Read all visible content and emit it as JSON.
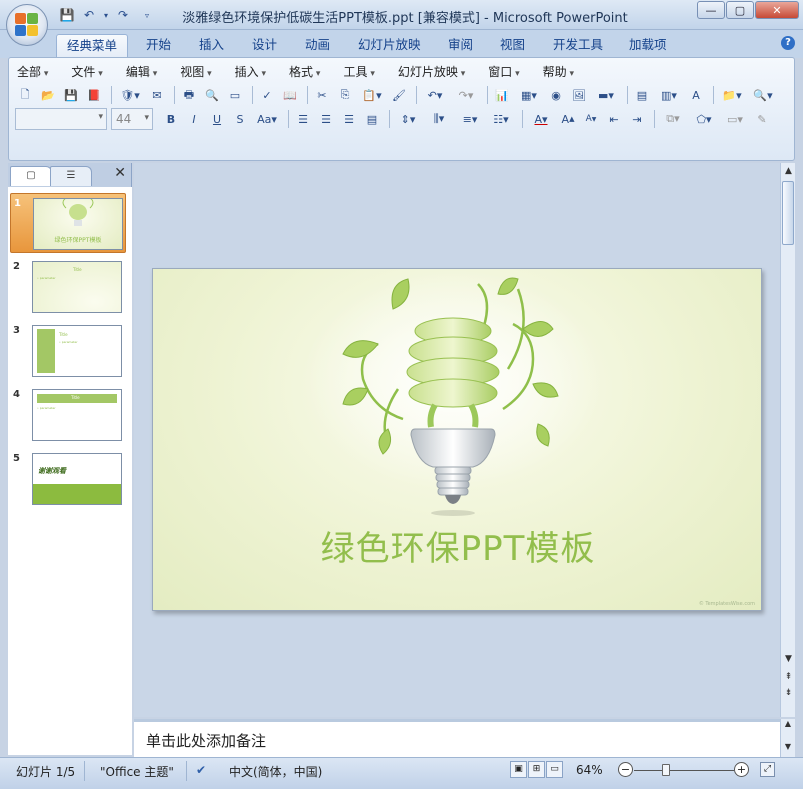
{
  "window": {
    "title": "淡雅绿色环境保护低碳生活PPT模板.ppt [兼容模式] - Microsoft PowerPoint",
    "minimize": "—",
    "maximize": "▢",
    "close": "✕"
  },
  "ribbon_tabs": [
    "经典菜单",
    "开始",
    "插入",
    "设计",
    "动画",
    "幻灯片放映",
    "审阅",
    "视图",
    "开发工具",
    "加载项"
  ],
  "active_tab": "经典菜单",
  "classic_menu": [
    "全部",
    "文件",
    "编辑",
    "视图",
    "插入",
    "格式",
    "工具",
    "幻灯片放映",
    "窗口",
    "帮助"
  ],
  "font_size_value": "44",
  "slides": [
    {
      "number": "1",
      "title": "绿色环保PPT模板",
      "selected": true
    },
    {
      "number": "2",
      "title": "Title",
      "text": "• parameter"
    },
    {
      "number": "3",
      "title": "Title",
      "text": "• parameter"
    },
    {
      "number": "4",
      "title": "Title",
      "text": "• parameter"
    },
    {
      "number": "5",
      "title": "谢谢观看"
    }
  ],
  "main_slide": {
    "title": "绿色环保PPT模板",
    "watermark": "© TemplatesWise.com"
  },
  "notes_placeholder": "单击此处添加备注",
  "status_bar": {
    "slide_indicator": "幻灯片 1/5",
    "theme": "\"Office 主题\"",
    "language": "中文(简体，中国)",
    "zoom": "64%",
    "zoom_fraction": 0.32
  },
  "colors": {
    "accent_green": "#92be4c",
    "selection_orange": "#e8963c",
    "office_blue": "#15428b"
  }
}
